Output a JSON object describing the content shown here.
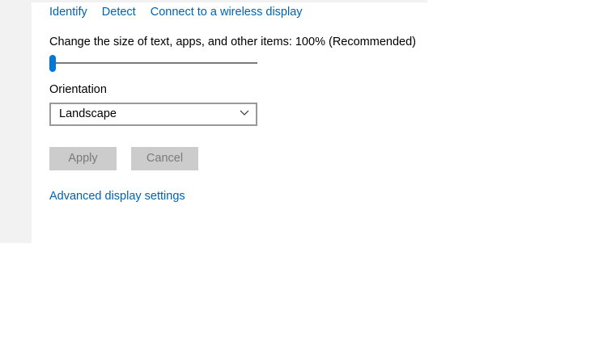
{
  "display_links": {
    "identify": "Identify",
    "detect": "Detect",
    "connect_wireless": "Connect to a wireless display"
  },
  "scale": {
    "label": "Change the size of text, apps, and other items: 100% (Recommended)",
    "slider_value_fraction": 0.0
  },
  "orientation": {
    "label": "Orientation",
    "selected": "Landscape"
  },
  "buttons": {
    "apply": "Apply",
    "cancel": "Cancel"
  },
  "advanced_link": "Advanced display settings",
  "colors": {
    "accent": "#0078d7",
    "link": "#0063b1",
    "disabled_button_bg": "#cccccc",
    "disabled_button_text": "#7a7a7a"
  },
  "icons": {
    "dropdown": "chevron-down-icon"
  }
}
